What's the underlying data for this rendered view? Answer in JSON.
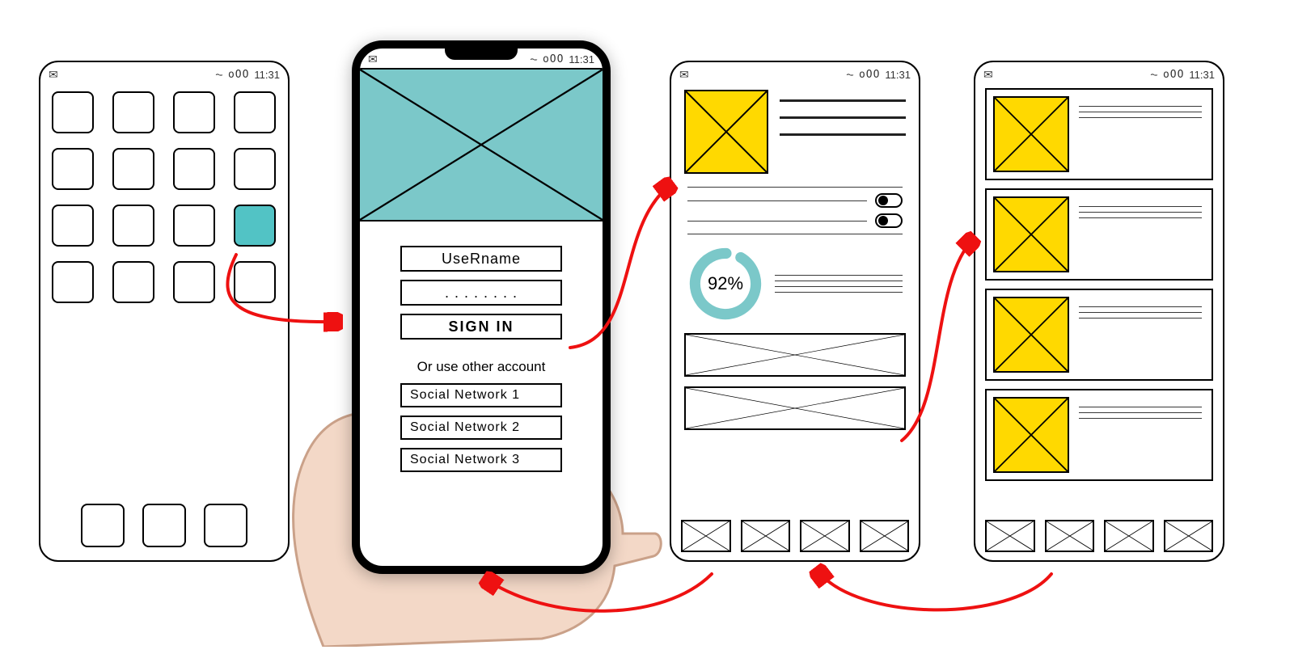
{
  "statusbar": {
    "signal": "oOO",
    "time": "11:31"
  },
  "screen2": {
    "username_label": "UseRname",
    "password_mask": ". . . . . . . .",
    "signin_label": "SIGN IN",
    "alt_label": "Or use other account",
    "social1": "Social Network 1",
    "social2": "Social Network 2",
    "social3": "Social Network 3"
  },
  "screen3": {
    "progress_label": "92%",
    "progress_value": 92
  },
  "colors": {
    "teal": "#7bc8c9",
    "yellow": "#ffd900",
    "arrow": "#e11"
  }
}
